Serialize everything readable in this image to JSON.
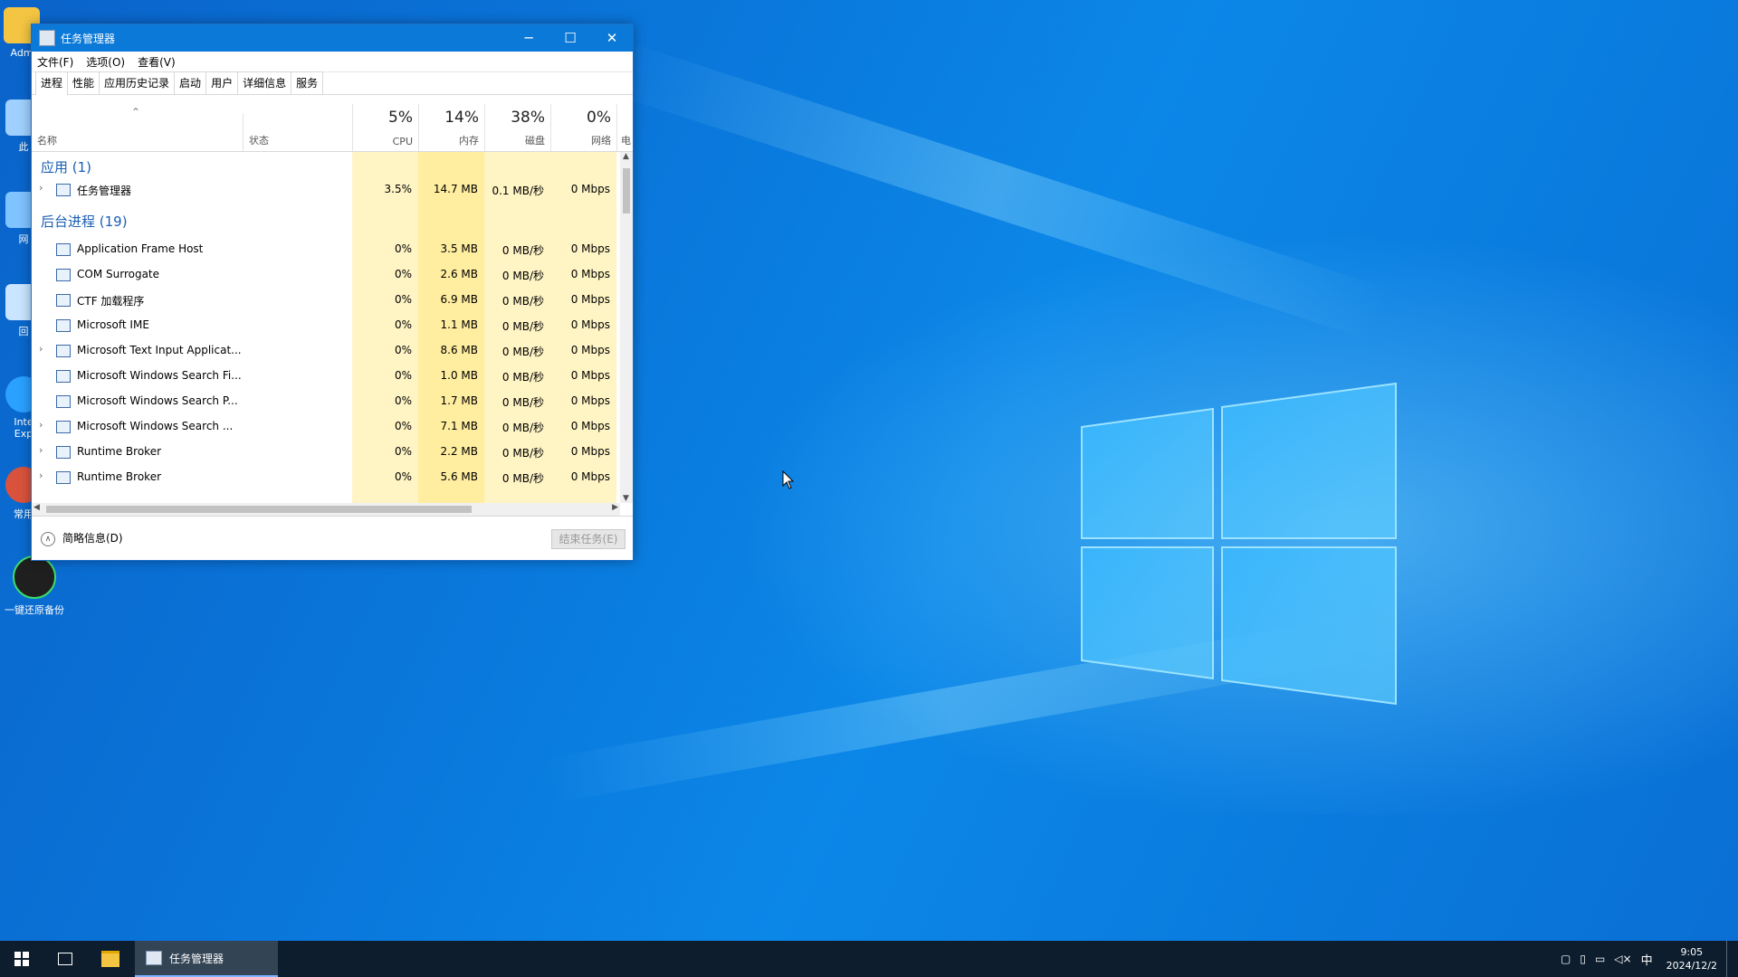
{
  "desktop": {
    "icons": [
      {
        "label": "Adm"
      },
      {
        "label": "此"
      },
      {
        "label": "网"
      },
      {
        "label": "回"
      },
      {
        "label": "Inte\nExp"
      },
      {
        "label": "常用"
      },
      {
        "label": "一键还原备份"
      }
    ]
  },
  "window": {
    "title": "任务管理器",
    "controls": {
      "minimize": "─",
      "maximize": "☐",
      "close": "✕"
    },
    "menu": [
      "文件(F)",
      "选项(O)",
      "查看(V)"
    ],
    "tabs": [
      "进程",
      "性能",
      "应用历史记录",
      "启动",
      "用户",
      "详细信息",
      "服务"
    ],
    "active_tab": "进程",
    "header": {
      "name_label": "名称",
      "status_label": "状态",
      "cpu": {
        "pct": "5%",
        "label": "CPU"
      },
      "mem": {
        "pct": "14%",
        "label": "内存"
      },
      "disk": {
        "pct": "38%",
        "label": "磁盘"
      },
      "net": {
        "pct": "0%",
        "label": "网络"
      },
      "extra": "电"
    },
    "groups": {
      "apps": "应用 (1)",
      "background": "后台进程 (19)"
    },
    "apps": [
      {
        "name": "任务管理器",
        "cpu": "3.5%",
        "mem": "14.7 MB",
        "disk": "0.1 MB/秒",
        "net": "0 Mbps",
        "expandable": true
      }
    ],
    "background": [
      {
        "name": "Application Frame Host",
        "cpu": "0%",
        "mem": "3.5 MB",
        "disk": "0 MB/秒",
        "net": "0 Mbps",
        "expandable": false
      },
      {
        "name": "COM Surrogate",
        "cpu": "0%",
        "mem": "2.6 MB",
        "disk": "0 MB/秒",
        "net": "0 Mbps",
        "expandable": false
      },
      {
        "name": "CTF 加载程序",
        "cpu": "0%",
        "mem": "6.9 MB",
        "disk": "0 MB/秒",
        "net": "0 Mbps",
        "expandable": false
      },
      {
        "name": "Microsoft IME",
        "cpu": "0%",
        "mem": "1.1 MB",
        "disk": "0 MB/秒",
        "net": "0 Mbps",
        "expandable": false
      },
      {
        "name": "Microsoft Text Input Applicat...",
        "cpu": "0%",
        "mem": "8.6 MB",
        "disk": "0 MB/秒",
        "net": "0 Mbps",
        "expandable": true
      },
      {
        "name": "Microsoft Windows Search Fi...",
        "cpu": "0%",
        "mem": "1.0 MB",
        "disk": "0 MB/秒",
        "net": "0 Mbps",
        "expandable": false
      },
      {
        "name": "Microsoft Windows Search P...",
        "cpu": "0%",
        "mem": "1.7 MB",
        "disk": "0 MB/秒",
        "net": "0 Mbps",
        "expandable": false
      },
      {
        "name": "Microsoft Windows Search ...",
        "cpu": "0%",
        "mem": "7.1 MB",
        "disk": "0 MB/秒",
        "net": "0 Mbps",
        "expandable": true
      },
      {
        "name": "Runtime Broker",
        "cpu": "0%",
        "mem": "2.2 MB",
        "disk": "0 MB/秒",
        "net": "0 Mbps",
        "expandable": true
      },
      {
        "name": "Runtime Broker",
        "cpu": "0%",
        "mem": "5.6 MB",
        "disk": "0 MB/秒",
        "net": "0 Mbps",
        "expandable": true
      }
    ],
    "footer": {
      "fewer_details": "简略信息(D)",
      "end_task": "结束任务(E)"
    }
  },
  "taskbar": {
    "active_app": "任务管理器",
    "ime": "中",
    "time": "9:05",
    "date": "2024/12/2"
  }
}
